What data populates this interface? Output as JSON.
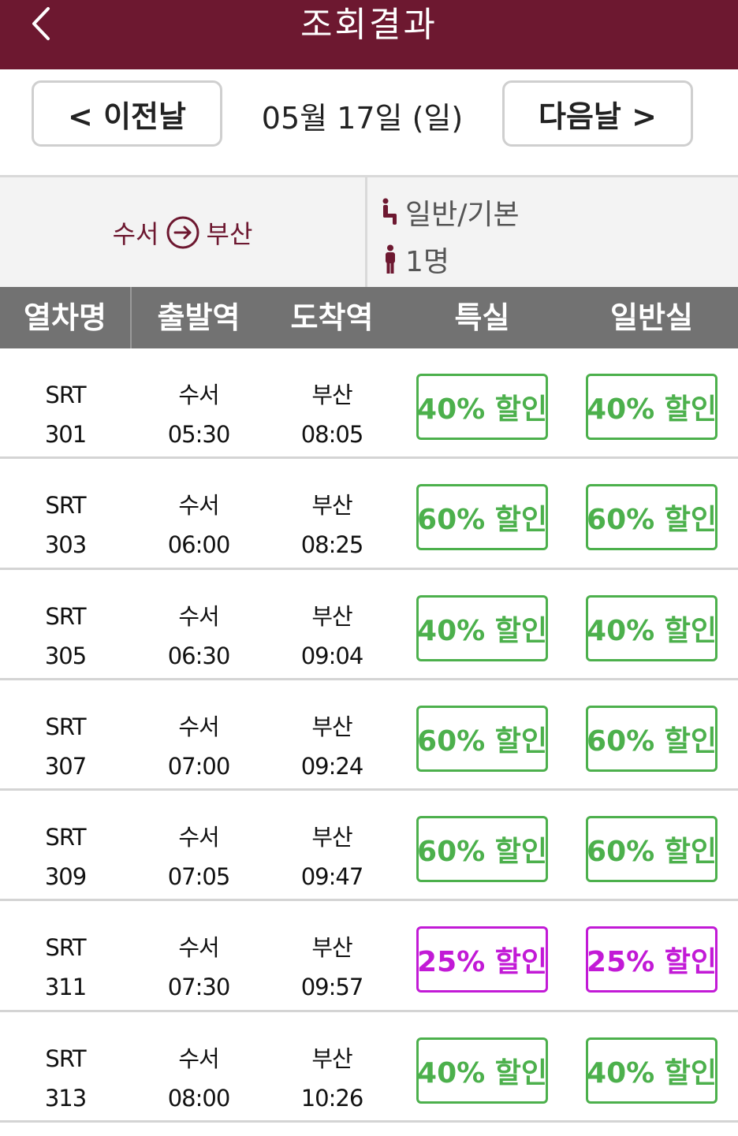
{
  "header": {
    "title": "조회결과"
  },
  "date_nav": {
    "prev_label": "< 이전날",
    "date": "05월 17일 (일)",
    "next_label": "다음날 >"
  },
  "info": {
    "origin": "수서",
    "destination": "부산",
    "seat_type": "일반/기본",
    "passengers": "1명"
  },
  "table": {
    "headers": [
      "열차명",
      "출발역",
      "도착역",
      "특실",
      "일반실"
    ],
    "rows": [
      {
        "train": "SRT",
        "number": "301",
        "dep_station": "수서",
        "dep_time": "05:30",
        "arr_station": "부산",
        "arr_time": "08:05",
        "special": "40% 할인",
        "normal": "40% 할인",
        "color": "#4cb04c"
      },
      {
        "train": "SRT",
        "number": "303",
        "dep_station": "수서",
        "dep_time": "06:00",
        "arr_station": "부산",
        "arr_time": "08:25",
        "special": "60% 할인",
        "normal": "60% 할인",
        "color": "#4cb04c"
      },
      {
        "train": "SRT",
        "number": "305",
        "dep_station": "수서",
        "dep_time": "06:30",
        "arr_station": "부산",
        "arr_time": "09:04",
        "special": "40% 할인",
        "normal": "40% 할인",
        "color": "#4cb04c"
      },
      {
        "train": "SRT",
        "number": "307",
        "dep_station": "수서",
        "dep_time": "07:00",
        "arr_station": "부산",
        "arr_time": "09:24",
        "special": "60% 할인",
        "normal": "60% 할인",
        "color": "#4cb04c"
      },
      {
        "train": "SRT",
        "number": "309",
        "dep_station": "수서",
        "dep_time": "07:05",
        "arr_station": "부산",
        "arr_time": "09:47",
        "special": "60% 할인",
        "normal": "60% 할인",
        "color": "#4cb04c"
      },
      {
        "train": "SRT",
        "number": "311",
        "dep_station": "수서",
        "dep_time": "07:30",
        "arr_station": "부산",
        "arr_time": "09:57",
        "special": "25% 할인",
        "normal": "25% 할인",
        "color": "#c21ad6"
      },
      {
        "train": "SRT",
        "number": "313",
        "dep_station": "수서",
        "dep_time": "08:00",
        "arr_station": "부산",
        "arr_time": "10:26",
        "special": "40% 할인",
        "normal": "40% 할인",
        "color": "#4cb04c"
      }
    ]
  },
  "icons": {
    "back": "chevron-left-icon",
    "route_arrow": "circle-arrow-right-icon",
    "seat": "seat-icon",
    "person": "person-icon"
  },
  "colors": {
    "brand": "#6d1830",
    "header_gray": "#727272",
    "discount_green": "#4cb04c",
    "discount_purple": "#c21ad6"
  }
}
